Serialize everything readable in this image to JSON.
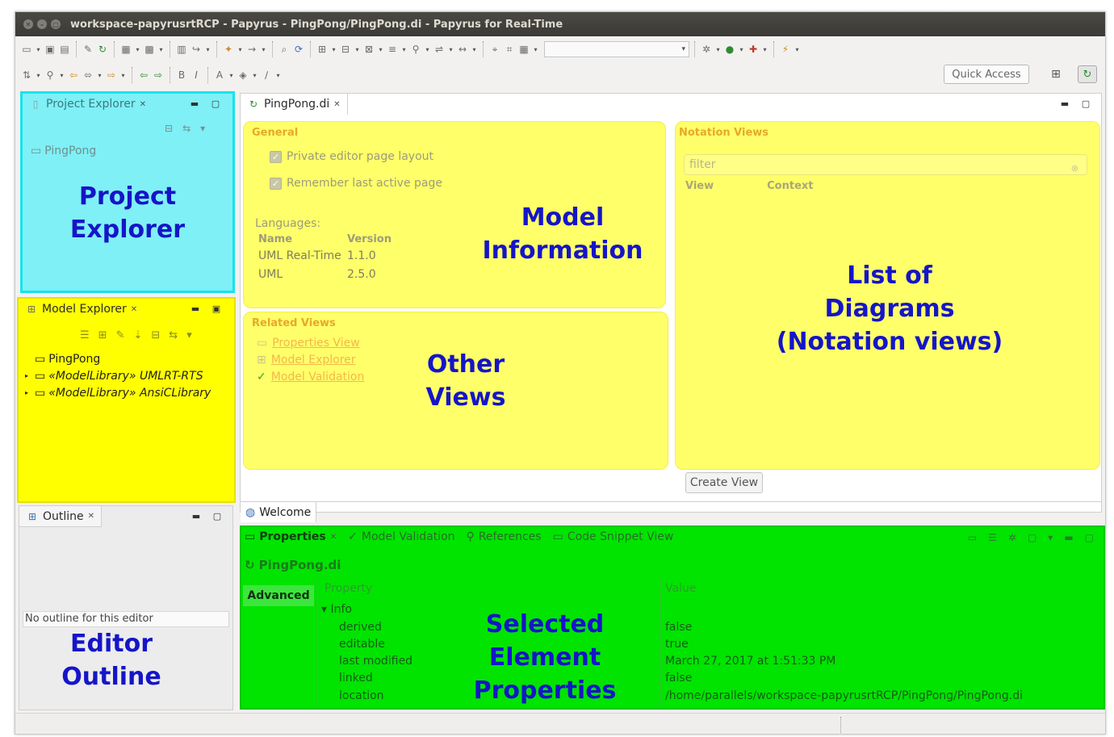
{
  "window": {
    "title": "workspace-papyrusrtRCP - Papyrus - PingPong/PingPong.di - Papyrus for Real-Time"
  },
  "toolbar": {
    "quick_access": "Quick Access"
  },
  "project_explorer": {
    "tab_label": "Project Explorer",
    "items": [
      "PingPong"
    ],
    "annotation_line1": "Project",
    "annotation_line2": "Explorer"
  },
  "model_explorer": {
    "tab_label": "Model Explorer",
    "items": [
      "PingPong",
      "«ModelLibrary» UMLRT-RTS",
      "«ModelLibrary» AnsiCLibrary"
    ]
  },
  "outline": {
    "tab_label": "Outline",
    "message": "No outline for this editor",
    "annotation_line1": "Editor",
    "annotation_line2": "Outline"
  },
  "editor": {
    "tab_label": "PingPong.di",
    "general": {
      "title": "General",
      "checkbox1": "Private editor page layout",
      "checkbox2": "Remember last active page",
      "languages_label": "Languages:",
      "col_name": "Name",
      "col_version": "Version",
      "languages": [
        {
          "name": "UML Real-Time",
          "version": "1.1.0"
        },
        {
          "name": "UML",
          "version": "2.5.0"
        }
      ],
      "annotation_line1": "Model",
      "annotation_line2": "Information"
    },
    "related_views": {
      "title": "Related Views",
      "links": [
        "Properties View",
        "Model Explorer",
        "Model Validation"
      ],
      "annotation_line1": "Other",
      "annotation_line2": "Views"
    },
    "notation_views": {
      "title": "Notation Views",
      "filter_placeholder": "filter",
      "col_view": "View",
      "col_context": "Context",
      "annotation_line1": "List of",
      "annotation_line2": "Diagrams",
      "annotation_line3": "(Notation views)"
    },
    "create_view_label": "Create View",
    "welcome_tab": "Welcome"
  },
  "properties": {
    "tabs": [
      "Properties",
      "Model Validation",
      "References",
      "Code Snippet View"
    ],
    "selected_element": "PingPong.di",
    "category": "Advanced",
    "col_property": "Property",
    "col_value": "Value",
    "group": "Info",
    "rows": [
      {
        "property": "derived",
        "value": "false"
      },
      {
        "property": "editable",
        "value": "true"
      },
      {
        "property": "last modified",
        "value": "March 27, 2017 at 1:51:33 PM"
      },
      {
        "property": "linked",
        "value": "false"
      },
      {
        "property": "location",
        "value": "/home/parallels/workspace-papyrusrtRCP/PingPong/PingPong.di"
      }
    ],
    "annotation_line1": "Selected",
    "annotation_line2": "Element",
    "annotation_line3": "Properties"
  }
}
